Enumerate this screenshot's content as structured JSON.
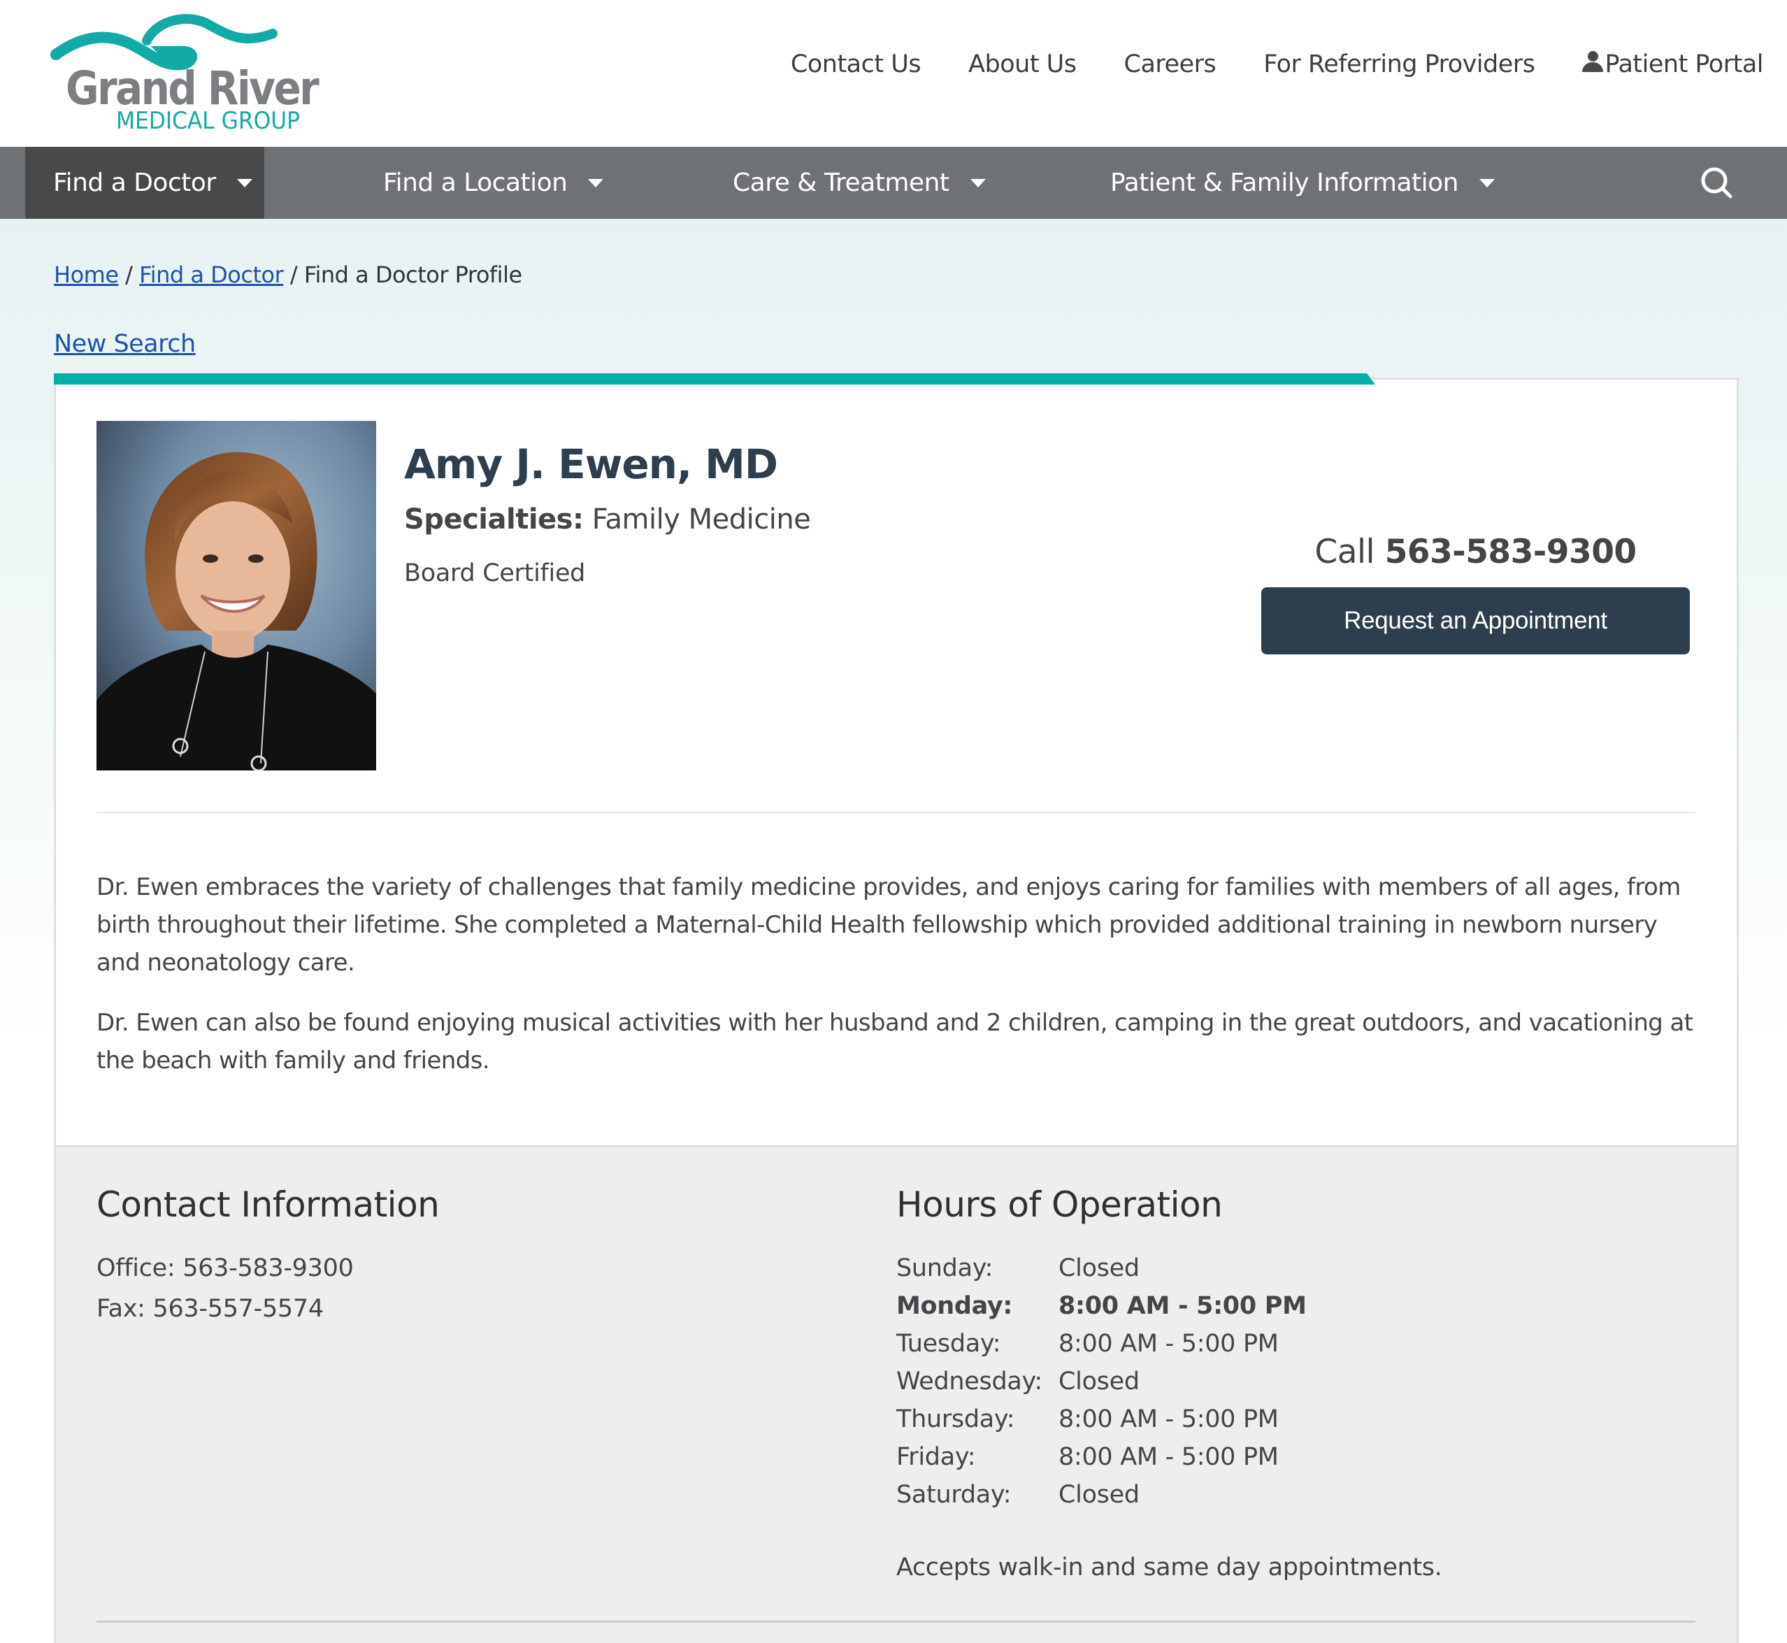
{
  "brand": {
    "name": "Grand River",
    "subtitle": "MEDICAL GROUP",
    "primary_color": "#7d7e82",
    "accent_color": "#00b1a7"
  },
  "top_links": [
    {
      "label": "Contact Us"
    },
    {
      "label": "About Us"
    },
    {
      "label": "Careers"
    },
    {
      "label": "For Referring Providers"
    },
    {
      "label": "Patient Portal",
      "icon": "person-icon"
    }
  ],
  "nav": {
    "items": [
      {
        "label": "Find a Doctor",
        "active": true
      },
      {
        "label": "Find a Location"
      },
      {
        "label": "Care & Treatment"
      },
      {
        "label": "Patient & Family Information"
      }
    ],
    "search_icon": "search-icon",
    "bg_color": "#6f7275",
    "active_color": "#48494b"
  },
  "breadcrumb": {
    "items": [
      {
        "label": "Home",
        "link": true
      },
      {
        "label": "Find a Doctor",
        "link": true
      },
      {
        "label": "Find a Doctor Profile",
        "link": false
      }
    ],
    "separator": "/"
  },
  "new_search_label": "New Search",
  "doctor": {
    "name": "Amy J. Ewen, MD",
    "specialties_label": "Specialties:",
    "specialties_value": "Family Medicine",
    "certification": "Board Certified",
    "photo_alt": "Portrait of Amy J. Ewen, MD"
  },
  "call": {
    "prefix": "Call",
    "phone": "563-583-9300"
  },
  "appointment_button": "Request an Appointment",
  "bio": [
    "Dr. Ewen embraces the variety of challenges that family medicine provides, and enjoys caring for families with members of all ages, from birth throughout their lifetime. She completed a Maternal-Child Health fellowship which provided additional training in newborn nursery and neonatology care.",
    "Dr. Ewen can also be found enjoying musical activities with her husband and 2 children, camping in the great outdoors, and vacationing at the beach with family and friends."
  ],
  "contact": {
    "title": "Contact Information",
    "office": "Office: 563-583-9300",
    "fax": "Fax: 563-557-5574"
  },
  "hours": {
    "title": "Hours of Operation",
    "rows": [
      {
        "day": "Sunday:",
        "time": "Closed"
      },
      {
        "day": "Monday:",
        "time": "8:00 AM - 5:00 PM",
        "today": true
      },
      {
        "day": "Tuesday:",
        "time": "8:00 AM - 5:00 PM"
      },
      {
        "day": "Wednesday:",
        "time": "Closed"
      },
      {
        "day": "Thursday:",
        "time": "8:00 AM - 5:00 PM"
      },
      {
        "day": "Friday:",
        "time": "8:00 AM - 5:00 PM"
      },
      {
        "day": "Saturday:",
        "time": "Closed"
      }
    ],
    "note": "Accepts walk-in and same day appointments."
  }
}
